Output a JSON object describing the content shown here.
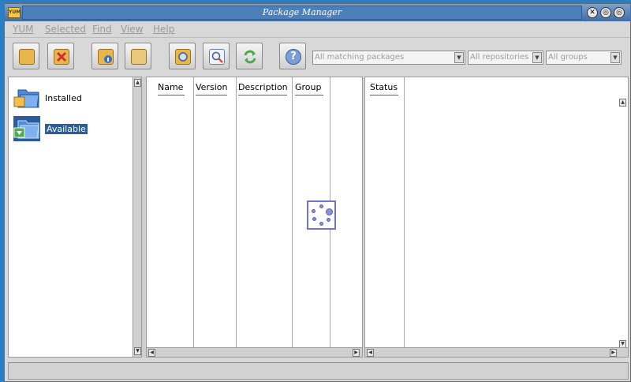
{
  "window": {
    "title": "Package Manager",
    "app_icon_text": "YUM",
    "controls": [
      "✕",
      "◎",
      "◎"
    ]
  },
  "menu": {
    "items": [
      "YUM",
      "Selected",
      "Find",
      "View",
      "Help"
    ]
  },
  "toolbar": {
    "buttons": [
      {
        "name": "install",
        "icon": "package-install-icon",
        "color": "#e8b64a"
      },
      {
        "name": "remove",
        "icon": "package-remove-icon",
        "color": "#e06060"
      },
      {
        "name": "info",
        "icon": "package-info-icon",
        "color": "#e8b64a"
      },
      {
        "name": "files",
        "icon": "package-files-icon",
        "color": "#e8c87a"
      },
      {
        "name": "search",
        "icon": "search-icon",
        "color": "#e8b64a"
      },
      {
        "name": "find",
        "icon": "magnifier-icon",
        "color": "#a8c0e0"
      },
      {
        "name": "refresh",
        "icon": "refresh-icon",
        "color": "#6cbf6c"
      },
      {
        "name": "help",
        "icon": "help-icon",
        "color": "#7a9ed8"
      }
    ],
    "filters": {
      "packages": "All matching packages",
      "repositories": "All repositories",
      "groups": "All groups"
    }
  },
  "sidebar": {
    "items": [
      {
        "label": "Installed",
        "selected": false,
        "icon": "folder-installed-icon"
      },
      {
        "label": "Available",
        "selected": true,
        "icon": "folder-available-icon"
      }
    ]
  },
  "table": {
    "columns": [
      "Name",
      "Version",
      "Description",
      "Group"
    ],
    "status_column": "Status"
  },
  "colors": {
    "desktop": "#2a7fc4",
    "titlebar": "#4d7fb8",
    "selection": "#2b5d9c",
    "disabled_text": "#9a9a9a",
    "busy_border": "#6f74cc"
  }
}
